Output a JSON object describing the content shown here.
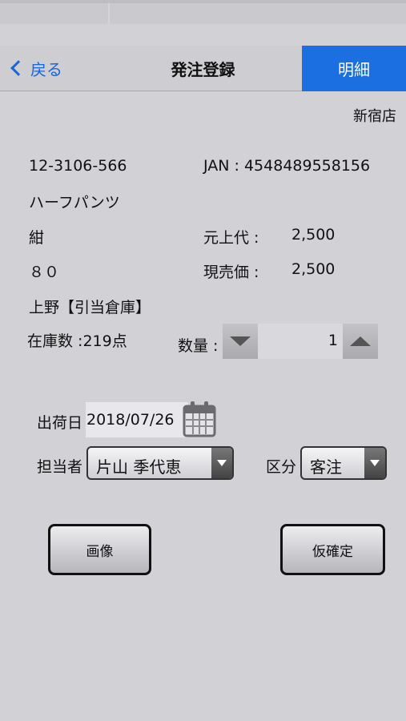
{
  "nav": {
    "back_label": "戻る",
    "title": "発注登録",
    "detail_label": "明細"
  },
  "store_name": "新宿店",
  "product": {
    "code": "12-3106-566",
    "jan": "JAN : 4548489558156",
    "name": "ハーフパンツ",
    "color": "紺",
    "size": "８０",
    "warehouse": "上野【引当倉庫】",
    "stock": "在庫数 :219点",
    "original_price_label": "元上代 :",
    "original_price": "2,500",
    "current_price_label": "現売価 :",
    "current_price": "2,500"
  },
  "quantity": {
    "label": "数量 :",
    "value": "1"
  },
  "shipping": {
    "date_label": "出荷日",
    "date_value": "2018/07/26",
    "staff_label": "担当者",
    "staff_value": "片山 季代恵",
    "category_label": "区分",
    "category_value": "客注"
  },
  "buttons": {
    "image": "画像",
    "confirm": "仮確定"
  },
  "colors": {
    "accent": "#1b6fe0",
    "background": "#d1d1d6"
  }
}
